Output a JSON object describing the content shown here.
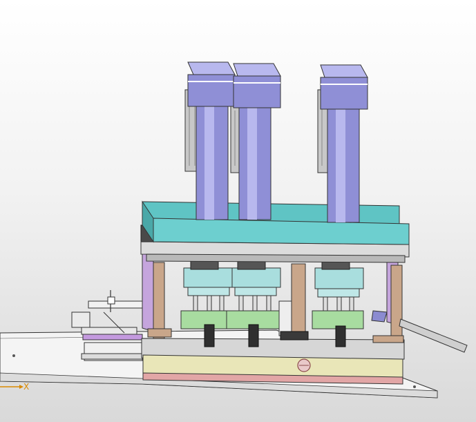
{
  "viewport": {
    "background_top": "#ffffff",
    "background_bottom": "#d9d9d9"
  },
  "triad": {
    "x_axis_label": "X",
    "color": "#d98a00"
  },
  "palette": {
    "cylinder": "#8f8fd6",
    "cylinder_light": "#b8b8ee",
    "motor_grey": "#c8c8c8",
    "top_plate": "#5fc4c4",
    "dark_plate": "#4a4a4a",
    "post": "#c9a68a",
    "fixture_green": "#a8dca0",
    "fixture_cyan": "#a9dede",
    "base_yellow": "#e9e6b8",
    "base_pink": "#e2a6a6",
    "side_purple": "#c5a5dd"
  }
}
